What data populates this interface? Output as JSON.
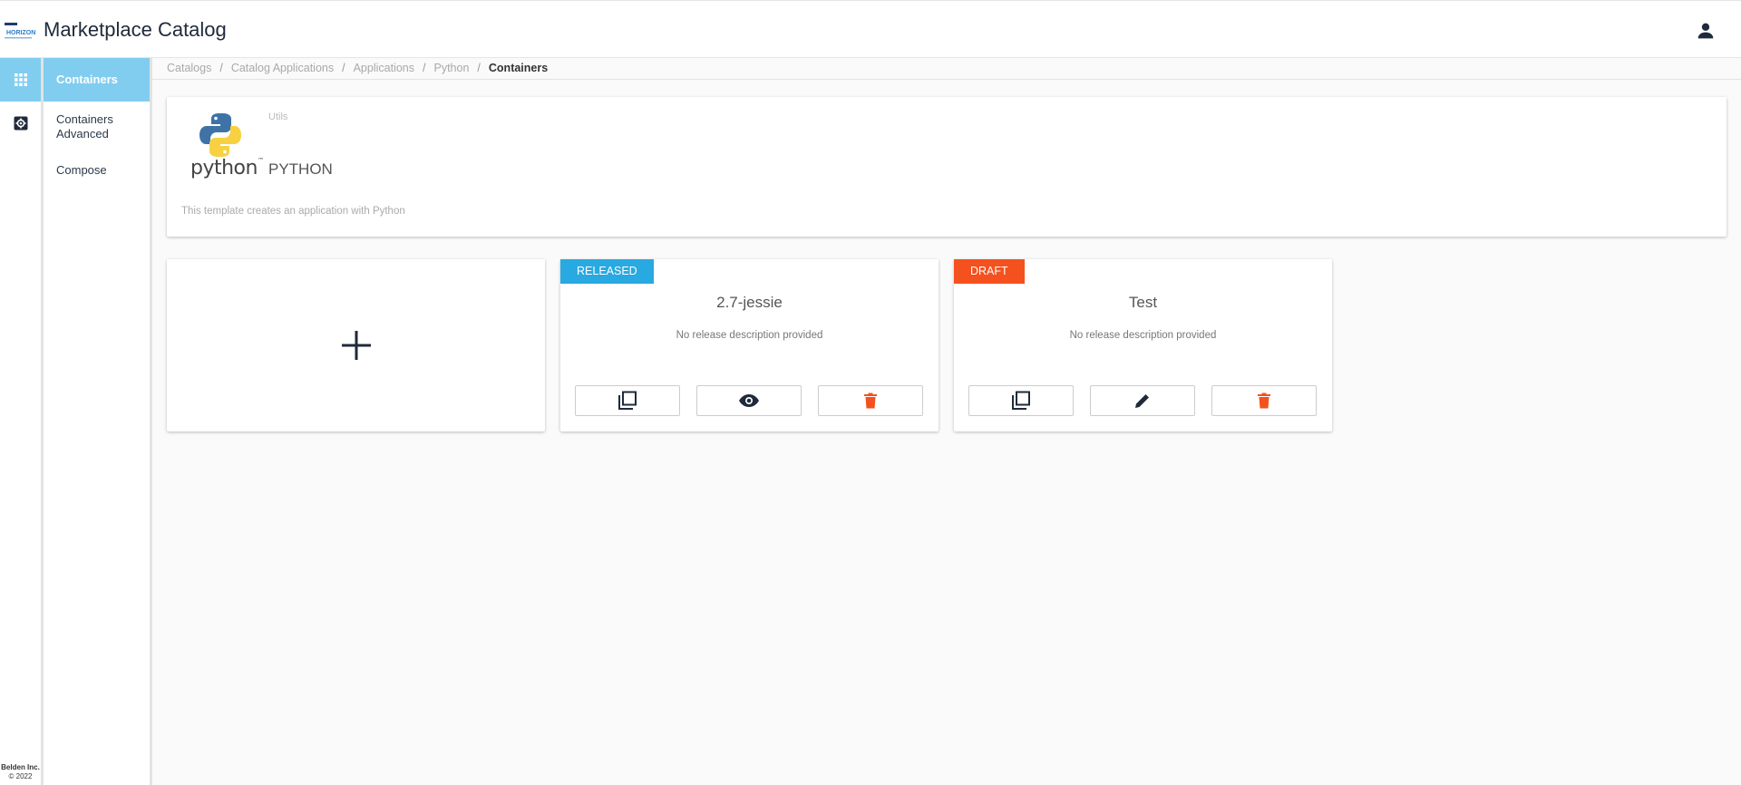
{
  "header": {
    "title": "Marketplace Catalog",
    "logo_text": "HORIZON"
  },
  "rail": {
    "footer_company": "Belden Inc.",
    "footer_copyright": "© 2022"
  },
  "subnav": {
    "items": [
      {
        "label": "Containers",
        "active": true
      },
      {
        "label": "Containers Advanced",
        "active": false
      },
      {
        "label": "Compose",
        "active": false
      }
    ]
  },
  "breadcrumb": {
    "items": [
      "Catalogs",
      "Catalog Applications",
      "Applications",
      "Python"
    ],
    "current": "Containers",
    "separator": "/"
  },
  "app": {
    "logo_word": "python",
    "logo_tm": "™",
    "category": "Utils",
    "name": "PYTHON",
    "description": "This template creates an application with Python"
  },
  "versions": [
    {
      "status": "RELEASED",
      "status_color": "#29a9e1",
      "title": "2.7-jessie",
      "description": "No release description provided",
      "actions": [
        "copy-icon",
        "eye-icon",
        "trash-icon"
      ]
    },
    {
      "status": "DRAFT",
      "status_color": "#f4511e",
      "title": "Test",
      "description": "No release description provided",
      "actions": [
        "copy-icon",
        "pencil-icon",
        "trash-icon"
      ]
    }
  ],
  "colors": {
    "accent": "#81cdf0",
    "danger": "#f4511e",
    "dark": "#1f2a3a"
  }
}
